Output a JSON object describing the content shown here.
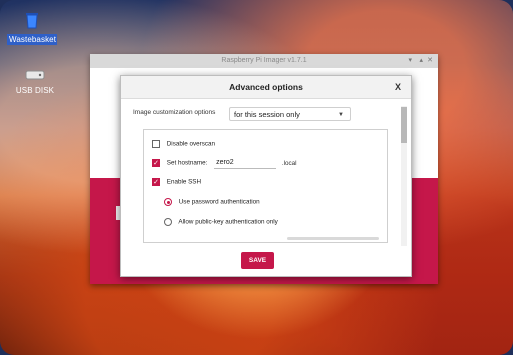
{
  "desktop": {
    "icons": [
      {
        "label": "Wastebasket",
        "icon": "trash-icon"
      },
      {
        "label": "USB DISK",
        "icon": "usb-disk-icon"
      }
    ]
  },
  "main_window": {
    "title": "Raspberry Pi Imager v1.7.1"
  },
  "dialog": {
    "title": "Advanced options",
    "close_label": "X",
    "customization_label": "Image customization options",
    "customization_value": "for this session only",
    "options": {
      "disable_overscan": "Disable overscan",
      "set_hostname": "Set hostname:",
      "hostname_value": "zero2",
      "hostname_suffix": ".local",
      "enable_ssh": "Enable SSH",
      "use_password": "Use password authentication",
      "allow_pubkey": "Allow public-key authentication only"
    },
    "save_label": "SAVE"
  },
  "colors": {
    "accent": "#c5174a"
  }
}
